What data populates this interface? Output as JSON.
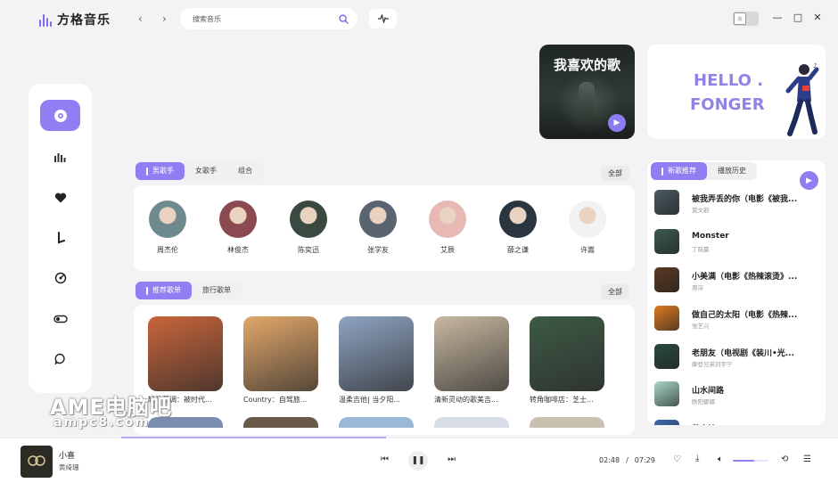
{
  "app": {
    "name": "方格音乐"
  },
  "search": {
    "placeholder": "搜索音乐"
  },
  "banner": {
    "favorite_title": "我喜欢的歌",
    "hello_line1": "HELLO .",
    "hello_line2": "FONGER"
  },
  "singers": {
    "tabs": [
      {
        "label": "男歌手",
        "active": true
      },
      {
        "label": "女歌手",
        "active": false
      },
      {
        "label": "组合",
        "active": false
      }
    ],
    "all_label": "全部",
    "items": [
      {
        "name": "周杰伦",
        "color": "#6f8a8e"
      },
      {
        "name": "林俊杰",
        "color": "#8a4a4f"
      },
      {
        "name": "陈奕迅",
        "color": "#3a4a40"
      },
      {
        "name": "张学友",
        "color": "#5a6470"
      },
      {
        "name": "艾辰",
        "color": "#e8b8b4"
      },
      {
        "name": "薛之谦",
        "color": "#2a3540"
      },
      {
        "name": "许嵩",
        "color": "#f2f2f2"
      }
    ]
  },
  "playlists": {
    "tabs": [
      {
        "label": "推荐歌单",
        "active": true
      },
      {
        "label": "旅行歌单",
        "active": false
      }
    ],
    "all_label": "全部",
    "items": [
      {
        "name": "轻盈蓝调：被时代...",
        "color": "#c9653a"
      },
      {
        "name": "Country：自驾旅...",
        "color": "#e3a86a"
      },
      {
        "name": "温柔吉他| 当夕阳...",
        "color": "#8fa4c2"
      },
      {
        "name": "清新灵动的歌美吉...",
        "color": "#c8b8a0"
      },
      {
        "name": "转角咖啡店：芝士...",
        "color": "#3d5a45"
      }
    ],
    "row2_colors": [
      "#7a8db0",
      "#6a5a4a",
      "#9ab8d8",
      "#d8dde8",
      "#c8c0b0"
    ]
  },
  "new_songs": {
    "tabs": [
      {
        "label": "新歌推荐",
        "active": true
      },
      {
        "label": "播放历史",
        "active": false
      }
    ],
    "items": [
      {
        "title": "被我弄丢的你（电影《被我...",
        "artist": "莫文蔚",
        "color": "#4a5a62"
      },
      {
        "title": "Monster",
        "artist": "丁筱赢",
        "color": "#3a5a50"
      },
      {
        "title": "小美满（电影《热辣滚烫》...",
        "artist": "周深",
        "color": "#5a3a22"
      },
      {
        "title": "做自己的太阳（电影《热辣...",
        "artist": "张艺兴",
        "color": "#e07a20"
      },
      {
        "title": "老朋友（电视剧《装川•光...",
        "artist": "摩登兄弟刘宇宁",
        "color": "#2a4a40"
      },
      {
        "title": "山水间路",
        "artist": "欧阳娜娜",
        "color": "#a8d8c8"
      },
      {
        "title": "苏小妹",
        "artist": "",
        "color": "#3a6ab0"
      }
    ]
  },
  "player": {
    "title": "小喜",
    "artist": "黄绮珊",
    "current_time": "02:48",
    "separator": "/",
    "total_time": "07:29",
    "progress": 0.37,
    "volume": 0.6
  },
  "watermark": {
    "line1": "AME电脑吧",
    "line2": "ampc8.com"
  },
  "colors": {
    "accent": "#8f7ff3",
    "background": "#f3f3f6"
  }
}
